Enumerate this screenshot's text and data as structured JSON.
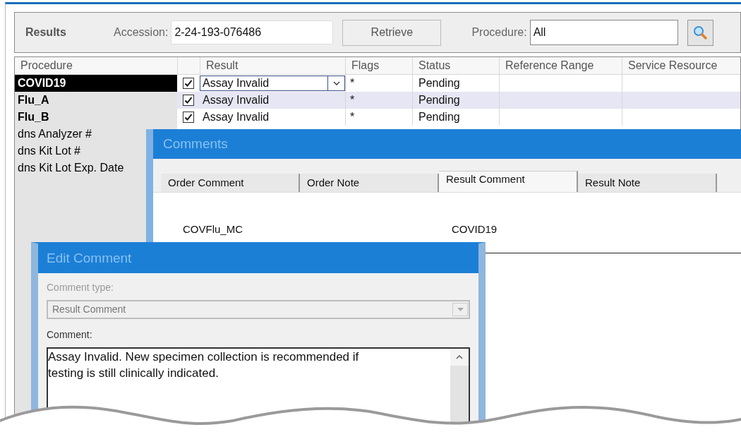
{
  "toolbar": {
    "title": "Results",
    "accession_label": "Accession:",
    "accession_value": "2-24-193-076486",
    "retrieve_button": "Retrieve",
    "procedure_label": "Procedure:",
    "procedure_value": "All"
  },
  "grid": {
    "columns": [
      "Procedure",
      "Result",
      "Flags",
      "Status",
      "Reference Range",
      "Service Resource"
    ],
    "rows": [
      {
        "kind": "result",
        "procedure": "COVID19",
        "selected": true,
        "checked": true,
        "result": "Assay Invalid",
        "editing": true,
        "flags": "*",
        "status": "Pending"
      },
      {
        "kind": "result",
        "procedure": "Flu_A",
        "selected": false,
        "checked": true,
        "result": "Assay Invalid",
        "editing": false,
        "flags": "*",
        "status": "Pending"
      },
      {
        "kind": "result",
        "procedure": "Flu_B",
        "selected": false,
        "checked": true,
        "result": "Assay Invalid",
        "editing": false,
        "flags": "*",
        "status": "Pending"
      },
      {
        "kind": "label",
        "procedure": "dns Analyzer #",
        "selected": false
      },
      {
        "kind": "label",
        "procedure": "dns Kit Lot #",
        "selected": false
      },
      {
        "kind": "label",
        "procedure": "dns Kit Lot Exp. Date",
        "selected": false
      }
    ]
  },
  "comments_dialog": {
    "title": "Comments",
    "tabs": [
      {
        "label": "Order Comment",
        "selected": false
      },
      {
        "label": "Order Note",
        "selected": false
      },
      {
        "label": "Result Comment",
        "selected": true
      },
      {
        "label": "Result Note",
        "selected": false
      }
    ],
    "entries": [
      {
        "column_1": "COVFlu_MC",
        "column_2": "COVID19"
      }
    ]
  },
  "edit_dialog": {
    "title": "Edit Comment",
    "type_label": "Comment type:",
    "type_value": "Result Comment",
    "type_disabled": true,
    "comment_label": "Comment:",
    "comment_value": "Assay Invalid. New specimen collection is recommended if testing is still clinically indicated."
  }
}
